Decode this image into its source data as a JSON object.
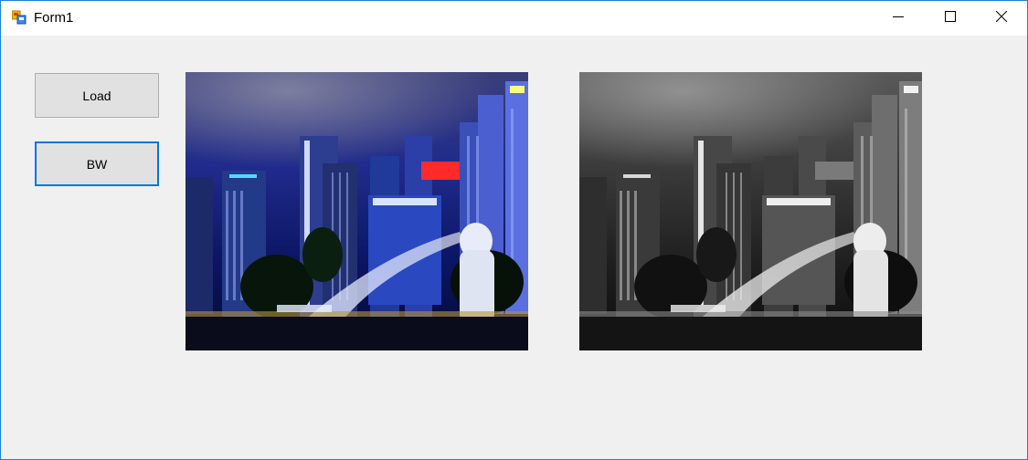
{
  "window": {
    "title": "Form1",
    "icon": "winforms-app-icon"
  },
  "caption_buttons": {
    "minimize_icon": "minimize-icon",
    "maximize_icon": "maximize-icon",
    "close_icon": "close-icon"
  },
  "buttons": {
    "load_label": "Load",
    "bw_label": "BW"
  },
  "images": {
    "original": {
      "description_icon": "city-night-photo",
      "color_mode": "color"
    },
    "processed": {
      "description_icon": "city-night-photo-grayscale",
      "color_mode": "grayscale"
    }
  },
  "colors": {
    "accent": "#0078d7",
    "window_border": "#1883d7",
    "client_bg": "#f0f0f0",
    "button_bg": "#e1e1e1"
  }
}
